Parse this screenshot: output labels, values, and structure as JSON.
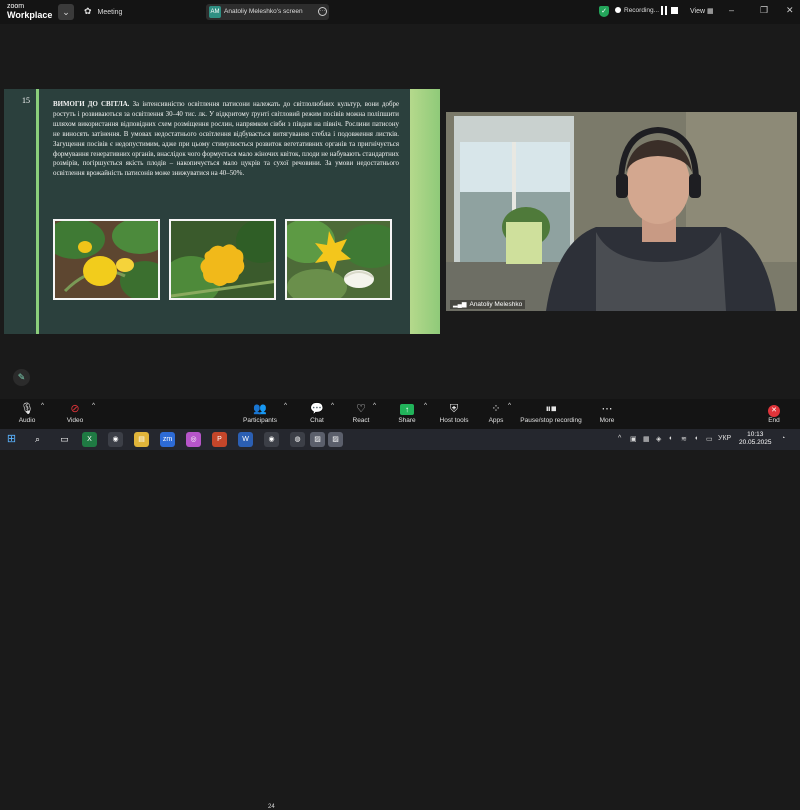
{
  "app": {
    "logo_line1": "zoom",
    "logo_line2": "Workplace"
  },
  "topbar": {
    "meeting_label": "Meeting",
    "presenter_initials": "AM",
    "screen_label": "Anatoliy Meleshko's screen",
    "recording_label": "Recording...",
    "view_label": "View"
  },
  "slide": {
    "number": "15",
    "heading": "ВИМОГИ ДО СВІТЛА.",
    "body": " За інтенсивністю освітлення патисони належать до світлолюбних культур, вони добре ростуть і розвиваються за освітлення 30–40 тис. лк. У відкритому ґрунті світловий режим посівів можна поліпшити шляхом використання відповідних схем розміщення рослин, напрямком сівби з півдня на північ. Рослини патисону не виносять затінення. В умовах недостатнього освітлення відбувається витягування стебла і подовження листків.  Загущення посівів є недопустимим, адже при цьому стимулюється розвиток вегетативних органів та пригнічується формування генеративних органів, внаслідок чого формується мало жіночих квіток, плоди не набувають стандартних розмірів, погіршується якість плодів – накопичується мало цукрів та сухої речовини. За умови недостатнього освітлення врожайність патисонів може знижуватися на 40–50%."
  },
  "webcam": {
    "participant_name": "Anatoliy Meleshko"
  },
  "toolbar": {
    "audio": "Audio",
    "video": "Video",
    "participants": "Participants",
    "participants_count": "24",
    "chat": "Chat",
    "react": "React",
    "share": "Share",
    "host_tools": "Host tools",
    "apps": "Apps",
    "pause_stop": "Pause/stop recording",
    "more": "More",
    "end": "End"
  },
  "taskbar": {
    "language": "УКР",
    "time": "10:13",
    "date": "20.05.2025"
  },
  "colors": {
    "slide_bg": "#2b403d",
    "slide_accent": "#8ccf7c",
    "share_green": "#21b35a",
    "end_red": "#e0343a",
    "shield_green": "#23a55a"
  }
}
